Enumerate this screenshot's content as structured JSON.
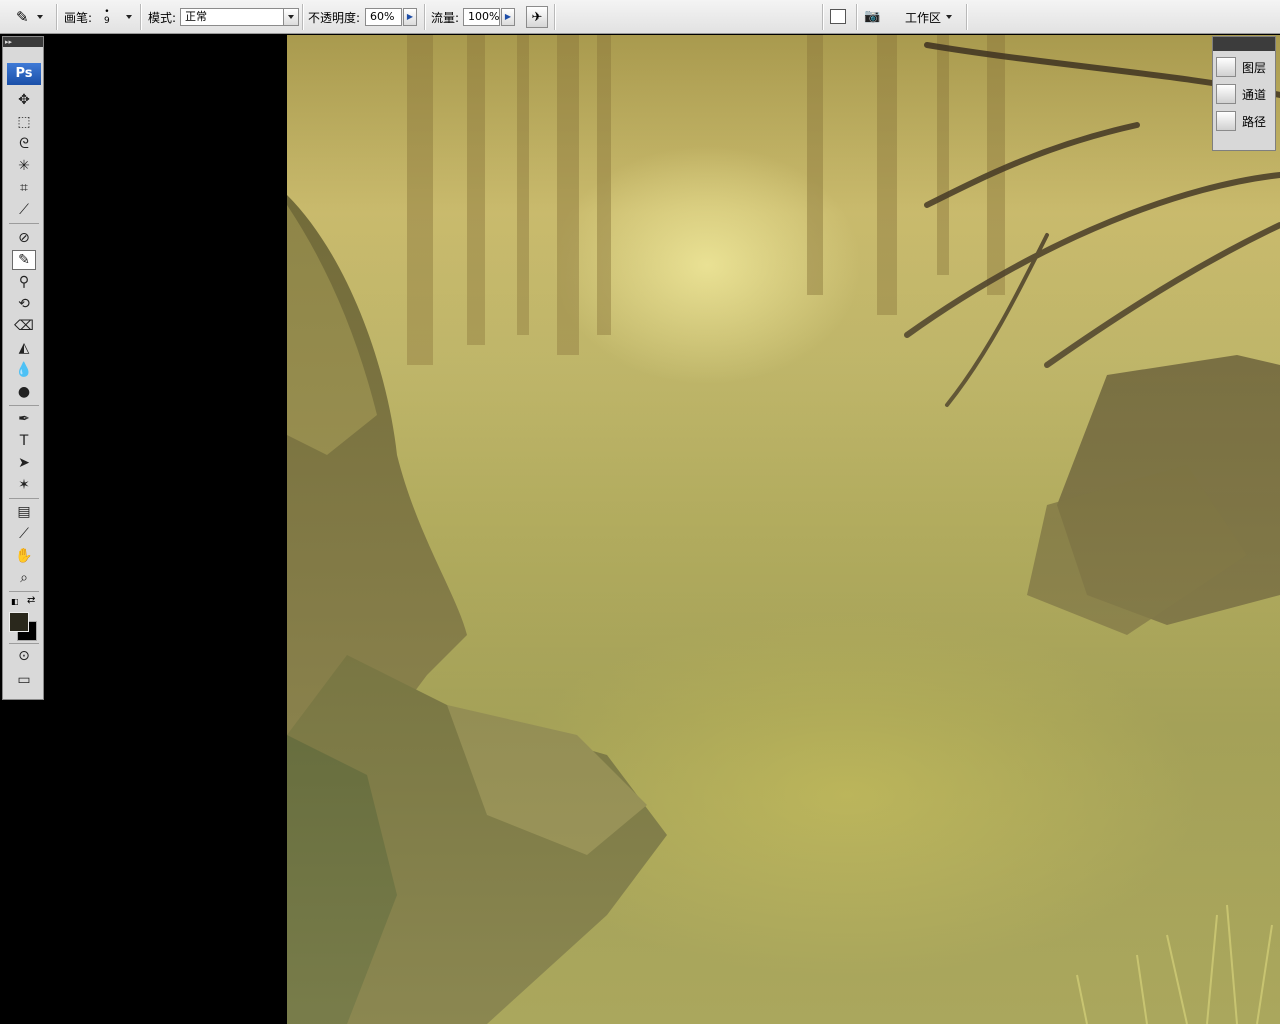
{
  "options_bar": {
    "brush_label": "画笔:",
    "brush_size": "9",
    "mode_label": "模式:",
    "mode_value": "正常",
    "opacity_label": "不透明度:",
    "opacity_value": "60%",
    "flow_label": "流量:",
    "flow_value": "100%",
    "workspace_label": "工作区"
  },
  "toolbox": {
    "logo": "Ps",
    "tools": [
      {
        "name": "move-tool-icon",
        "glyph": "✥"
      },
      {
        "name": "marquee-tool-icon",
        "glyph": "⬚"
      },
      {
        "name": "lasso-tool-icon",
        "glyph": "ᘓ"
      },
      {
        "name": "magic-wand-tool-icon",
        "glyph": "✳"
      },
      {
        "name": "crop-tool-icon",
        "glyph": "⌗"
      },
      {
        "name": "slice-tool-icon",
        "glyph": "⟋"
      },
      {
        "name": "healing-brush-tool-icon",
        "glyph": "⊘"
      },
      {
        "name": "brush-tool-icon",
        "glyph": "✎"
      },
      {
        "name": "clone-stamp-tool-icon",
        "glyph": "⚲"
      },
      {
        "name": "history-brush-tool-icon",
        "glyph": "⟲"
      },
      {
        "name": "eraser-tool-icon",
        "glyph": "⌫"
      },
      {
        "name": "paint-bucket-tool-icon",
        "glyph": "◭"
      },
      {
        "name": "blur-tool-icon",
        "glyph": "💧"
      },
      {
        "name": "dodge-tool-icon",
        "glyph": "●"
      },
      {
        "name": "pen-tool-icon",
        "glyph": "✒"
      },
      {
        "name": "type-tool-icon",
        "glyph": "T"
      },
      {
        "name": "path-selection-tool-icon",
        "glyph": "➤"
      },
      {
        "name": "custom-shape-tool-icon",
        "glyph": "✶"
      },
      {
        "name": "notes-tool-icon",
        "glyph": "▤"
      },
      {
        "name": "eyedropper-tool-icon",
        "glyph": "⟋"
      },
      {
        "name": "hand-tool-icon",
        "glyph": "✋"
      },
      {
        "name": "zoom-tool-icon",
        "glyph": "⌕"
      }
    ],
    "foreground_color": "#2a281c",
    "background_color": "#000000"
  },
  "dock": {
    "items": [
      {
        "label": "图层",
        "icon": "layers-icon"
      },
      {
        "label": "通道",
        "icon": "channels-icon"
      },
      {
        "label": "路径",
        "icon": "paths-icon"
      }
    ]
  },
  "canvas": {
    "subject": "painting of a misty forest path"
  }
}
